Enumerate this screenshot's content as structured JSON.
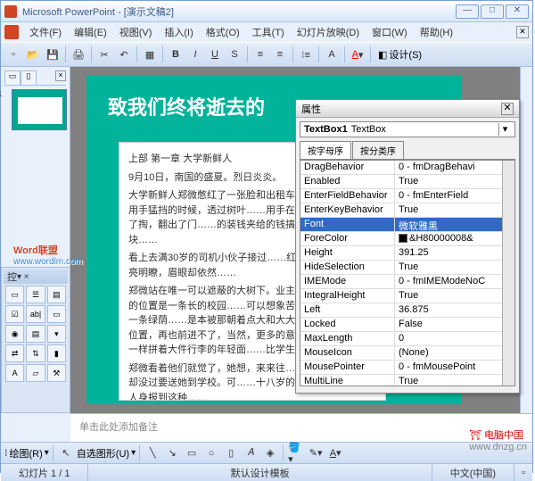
{
  "window": {
    "title": "Microsoft PowerPoint - [演示文稿2]"
  },
  "menu": {
    "file": "文件(F)",
    "edit": "编辑(E)",
    "view": "视图(V)",
    "insert": "插入(I)",
    "format": "格式(O)",
    "tools": "工具(T)",
    "slideshow": "幻灯片放映(D)",
    "window1": "窗口(W)",
    "help": "帮助(H)"
  },
  "toolbar": {
    "design": "设计(S)"
  },
  "outline": {
    "slidenum": "1"
  },
  "toolbox": {
    "header": "控"
  },
  "slide": {
    "title": "致我们终将逝去的",
    "p1": "上部 第一章 大学新鲜人",
    "p2": "9月10日，南国的盛夏。烈日炎炎。",
    "p3": "大学新鲜人郑微憋红了一张脸和出租车……下了车，抬头用手猛挡的时候，透过树叶……用手在牛仔裤的口袋里掏了掏，翻出了门……的装钱夹给的钱搞定，连零带整，五块……",
    "p4": "看上去满30岁的司机小伙子接过……红脸，吹着浪漫的清亮明瞭，眉眼却依然……",
    "p5": "郑微站在唯一可以遮蔽的大树下。业主……在哪，她所在的位置是一条长的校园……可以想象苦日的时候步在这样一条绿荫……是本被那朝着点大和大大小小的不……诗的位置，再也前进不了，当然，更多的意……的，都是像她一样拼着大件行李的年轻面……比学生来得晚些。",
    "p6": "郑微看着他们就觉了，她想，来来往……吧，爸爸和妈妈却没过要送她到学校。可……十八岁的豆蔻少女，谁谁谁人身报到这种……"
  },
  "props": {
    "title": "属性",
    "obj_name": "TextBox1",
    "obj_type": "TextBox",
    "tab_alpha": "按字母序",
    "tab_cat": "按分类序",
    "rows": [
      {
        "n": "DragBehavior",
        "v": "0 - fmDragBehavi"
      },
      {
        "n": "Enabled",
        "v": "True"
      },
      {
        "n": "EnterFieldBehavior",
        "v": "0 - fmEnterField"
      },
      {
        "n": "EnterKeyBehavior",
        "v": "True"
      },
      {
        "n": "Font",
        "v": "微软雅黑",
        "sel": true
      },
      {
        "n": "ForeColor",
        "v": "&H80000008&",
        "color": true
      },
      {
        "n": "Height",
        "v": "391.25"
      },
      {
        "n": "HideSelection",
        "v": "True"
      },
      {
        "n": "IMEMode",
        "v": "0 - fmIMEModeNoC"
      },
      {
        "n": "IntegralHeight",
        "v": "True"
      },
      {
        "n": "Left",
        "v": "36.875"
      },
      {
        "n": "Locked",
        "v": "False"
      },
      {
        "n": "MaxLength",
        "v": "0"
      },
      {
        "n": "MouseIcon",
        "v": "(None)"
      },
      {
        "n": "MousePointer",
        "v": "0 - fmMousePoint"
      },
      {
        "n": "MultiLine",
        "v": "True"
      }
    ]
  },
  "watermark": {
    "brand": "Word联盟",
    "url": "www.wordlm.com"
  },
  "notes": {
    "placeholder": "单击此处添加备注"
  },
  "drawbar": {
    "draw": "绘图(R)",
    "autoshape": "自选图形(U)"
  },
  "status": {
    "slide": "幻灯片 1 / 1",
    "template": "默认设计模板",
    "lang": "中文(中国)"
  },
  "footer": {
    "site": "电脑中国",
    "url": "www.dnzg.cn"
  }
}
